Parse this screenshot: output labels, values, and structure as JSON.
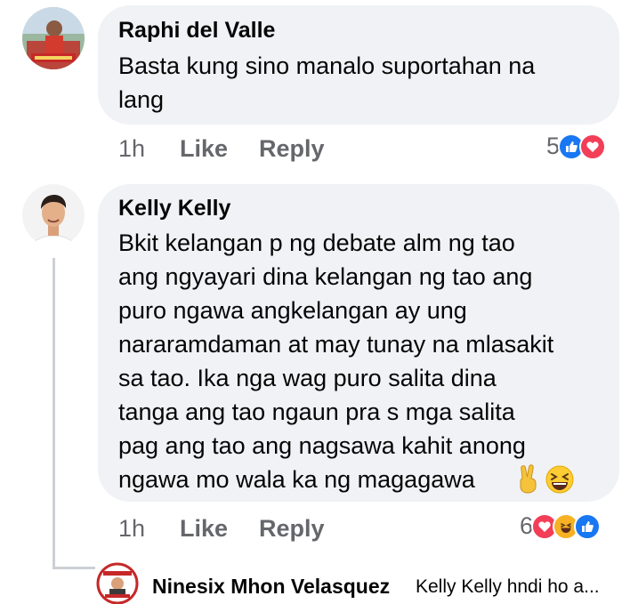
{
  "comments": [
    {
      "author": "Raphi del Valle",
      "text": "Basta kung sino manalo suportahan na\nlang",
      "time": "1h",
      "like_label": "Like",
      "reply_label": "Reply",
      "reaction_count": "5",
      "reactions": [
        "like-icon",
        "love-icon"
      ]
    },
    {
      "author": "Kelly Kelly",
      "text": "Bkit kelangan p ng debate alm ng tao\nang ngyayari dina kelangan ng tao ang\npuro ngawa angkelangan ay ung\nnararamdaman at may tunay na mlasakit\nsa tao. Ika nga wag puro salita dina\ntanga ang tao ngaun pra s mga salita\npag ang tao ang nagsawa kahit anong\nngawa mo wala ka ng magagawa",
      "emoji": [
        "victory-hand-emoji",
        "laughing-emoji"
      ],
      "time": "1h",
      "like_label": "Like",
      "reply_label": "Reply",
      "reaction_count": "6",
      "reactions": [
        "love-icon",
        "haha-icon",
        "like-icon"
      ]
    }
  ],
  "reply": {
    "author": "Ninesix Mhon Velasquez",
    "preview": "Kelly Kelly hndi ho a..."
  },
  "colors": {
    "bubble": "#f0f2f5",
    "like_blue": "#1877f2",
    "love_red": "#f33e58",
    "haha_yellow": "#f7b125",
    "meta_gray": "#65676b"
  }
}
